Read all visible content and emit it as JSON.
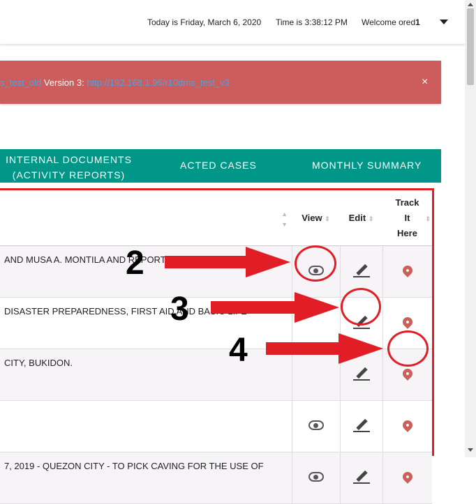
{
  "header": {
    "date_text": "Today is Friday, March 6, 2020",
    "time_text": "Time is 3:38:12 PM",
    "welcome_text": "Welcome ored",
    "username_bold": "1"
  },
  "alert": {
    "link1_text": "s_test_old",
    "middle_text": " Version 3: ",
    "link2_text": "http://192.168.1.96/r10dms_test_v3",
    "close_label": "×"
  },
  "tabs": [
    {
      "line1": "INTERNAL DOCUMENTS",
      "line2": "(ACTIVITY REPORTS)"
    },
    {
      "line1": "ACTED CASES"
    },
    {
      "line1": "MONTHLY SUMMARY"
    }
  ],
  "table": {
    "columns": {
      "view": "View",
      "edit": "Edit",
      "track1": "Track",
      "track2": "It",
      "track3": "Here"
    },
    "rows": [
      {
        "text": "AND MUSA A. MONTILA AND REPORT TO CENTRAL OFFICE"
      },
      {
        "text": " DISASTER PREPAREDNESS, FIRST AID AND BASIC LIFE"
      },
      {
        "text": "CITY, BUKIDON."
      },
      {
        "text": ""
      },
      {
        "text": " 7, 2019 - QUEZON CITY - TO PICK CAVING FOR THE USE OF"
      }
    ]
  },
  "annotations": {
    "n2": "2",
    "n3": "3",
    "n4": "4"
  },
  "colors": {
    "teal": "#009688",
    "alert": "#cd5c5c",
    "annotation_red": "#e11d26",
    "pin": "#c9605a"
  }
}
